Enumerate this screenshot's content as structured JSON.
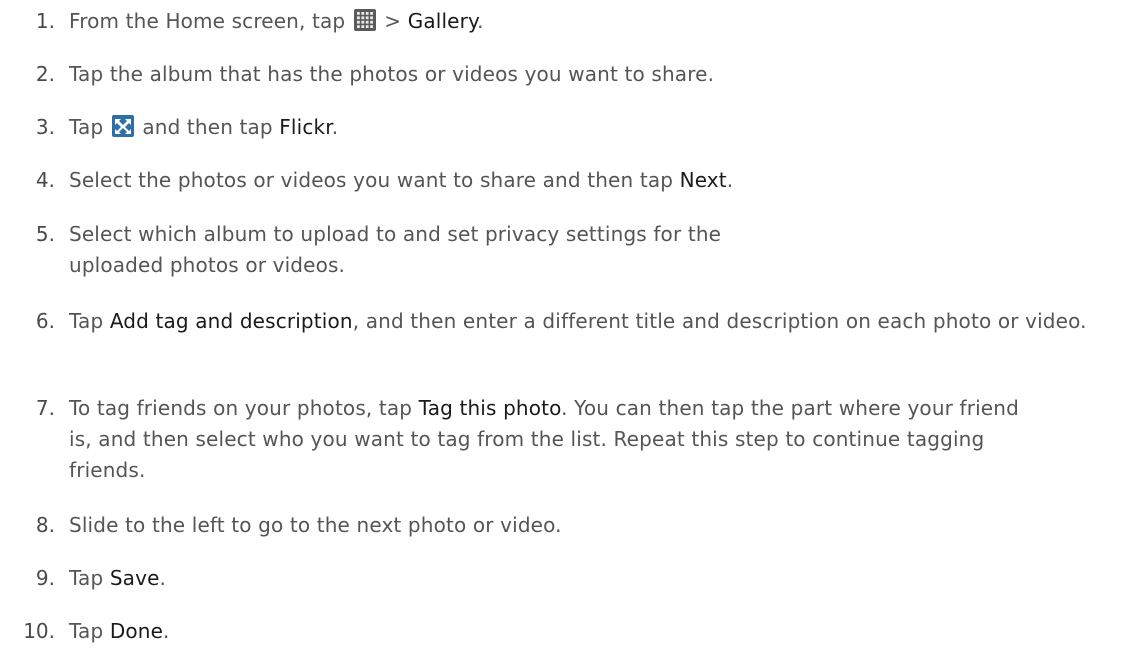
{
  "icons": {
    "apps": "apps-grid-icon",
    "share": "share-icon"
  },
  "steps": [
    {
      "num": "1.",
      "parts": [
        {
          "t": "From the Home screen, tap "
        },
        {
          "icon": "apps"
        },
        {
          "t": " > "
        },
        {
          "t": "Gallery",
          "b": true
        },
        {
          "t": "."
        }
      ]
    },
    {
      "num": "2.",
      "parts": [
        {
          "t": "Tap the album that has the photos or videos you want to share."
        }
      ]
    },
    {
      "num": "3.",
      "parts": [
        {
          "t": "Tap "
        },
        {
          "icon": "share"
        },
        {
          "t": " and then tap "
        },
        {
          "t": "Flickr",
          "b": true
        },
        {
          "t": "."
        }
      ]
    },
    {
      "num": "4.",
      "parts": [
        {
          "t": "Select the photos or videos you want to share and then tap "
        },
        {
          "t": "Next",
          "b": true
        },
        {
          "t": "."
        }
      ]
    },
    {
      "num": "5.",
      "parts": [
        {
          "t": "Select which album to upload to and set privacy settings for the uploaded photos or videos."
        }
      ]
    },
    {
      "num": "6.",
      "parts": [
        {
          "t": "Tap "
        },
        {
          "t": "Add tag and description",
          "b": true
        },
        {
          "t": ", and then enter a different title and description on each photo or video."
        }
      ]
    },
    {
      "num": "7.",
      "parts": [
        {
          "t": "To tag friends on your photos, tap "
        },
        {
          "t": "Tag this photo",
          "b": true
        },
        {
          "t": ". You can then tap the part where your friend is, and then select who you want to tag from the list. Repeat this step to continue tagging friends."
        }
      ]
    },
    {
      "num": "8.",
      "parts": [
        {
          "t": "Slide to the left to go to the next photo or video."
        }
      ]
    },
    {
      "num": "9.",
      "parts": [
        {
          "t": "Tap "
        },
        {
          "t": "Save",
          "b": true
        },
        {
          "t": "."
        }
      ]
    },
    {
      "num": "10.",
      "parts": [
        {
          "t": "Tap "
        },
        {
          "t": "Done",
          "b": true
        },
        {
          "t": "."
        }
      ]
    }
  ]
}
